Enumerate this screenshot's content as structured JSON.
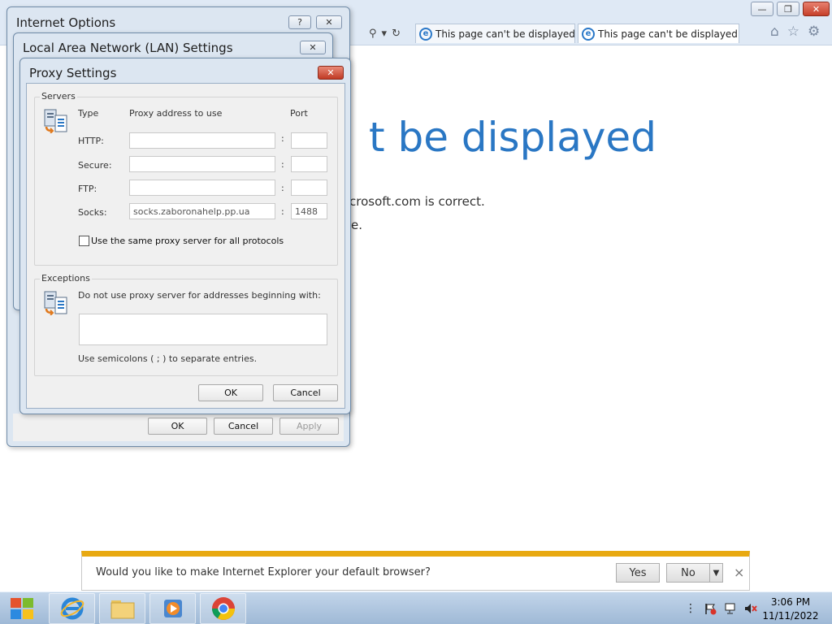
{
  "browser": {
    "tabs": [
      {
        "label": "This page can't be displayed"
      },
      {
        "label": "This page can't be displayed"
      }
    ],
    "tab_close_glyph": "×",
    "controls": {
      "minimize": "—",
      "restore": "❐",
      "close": "✕"
    },
    "address_glyphs": {
      "search": "⚲",
      "dropdown": "▾",
      "refresh": "↻"
    },
    "toolbar_glyphs": {
      "home": "⌂",
      "favorites": "☆",
      "tools": "⚙"
    }
  },
  "page": {
    "title_fragment": "t be displayed",
    "line1_fragment": "crosoft.com is correct.",
    "line2_fragment": "e."
  },
  "internet_options": {
    "title": "Internet Options",
    "help_glyph": "?",
    "close_glyph": "✕",
    "ok_label": "OK",
    "cancel_label": "Cancel",
    "apply_label": "Apply"
  },
  "lan_settings": {
    "title": "Local Area Network (LAN) Settings",
    "close_glyph": "✕"
  },
  "proxy_settings": {
    "title": "Proxy Settings",
    "close_glyph": "✕",
    "servers": {
      "group_label": "Servers",
      "col_type": "Type",
      "col_address": "Proxy address to use",
      "col_port": "Port",
      "rows": [
        {
          "type": "HTTP:",
          "address": "",
          "port": ""
        },
        {
          "type": "Secure:",
          "address": "",
          "port": ""
        },
        {
          "type": "FTP:",
          "address": "",
          "port": ""
        },
        {
          "type": "Socks:",
          "address": "socks.zaboronahelp.pp.ua",
          "port": "1488"
        }
      ],
      "colon": ":",
      "same_proxy_label": "Use the same proxy server for all protocols",
      "same_proxy_checked": false
    },
    "exceptions": {
      "group_label": "Exceptions",
      "instruction": "Do not use proxy server for addresses beginning with:",
      "value": "",
      "hint": "Use semicolons ( ; ) to separate entries."
    },
    "ok_label": "OK",
    "cancel_label": "Cancel"
  },
  "notification": {
    "text": "Would you like to make Internet Explorer your default browser?",
    "yes_label": "Yes",
    "no_label": "No",
    "close_glyph": "×"
  },
  "taskbar": {
    "time": "3:06 PM",
    "date": "11/11/2022"
  },
  "colors": {
    "accent_blue": "#2a77c4",
    "notification_bar": "#e8a911",
    "close_red": "#c03a24"
  }
}
